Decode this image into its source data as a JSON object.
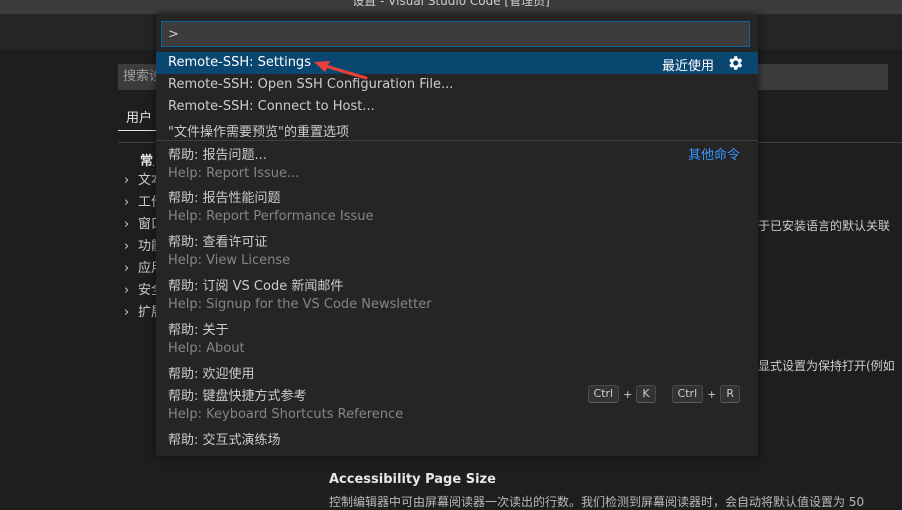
{
  "window": {
    "title": "设置 - Visual Studio Code [管理员]"
  },
  "settings": {
    "search_placeholder": "搜索设",
    "user_tab": "用户",
    "toc_heading": "常用",
    "toc_items": [
      "文本",
      "工作",
      "窗口",
      "功能",
      "应用",
      "安全",
      "扩展"
    ],
    "right_fragment_1": "于已安装语言的默认关联",
    "right_fragment_2": "显式设置为保持打开(例如",
    "setting_title": "Accessibility Page Size",
    "setting_desc": "控制编辑器中可由屏幕阅读器一次读出的行数。我们检测到屏幕阅读器时，会自动将默认值设置为 50"
  },
  "palette": {
    "input_value": ">",
    "recently_used": "最近使用",
    "other_commands": "其他命令",
    "items": [
      {
        "label": "Remote-SSH: Settings"
      },
      {
        "label": "Remote-SSH: Open SSH Configuration File..."
      },
      {
        "label": "Remote-SSH: Connect to Host..."
      },
      {
        "label": "\"文件操作需要预览\"的重置选项"
      },
      {
        "label": "帮助: 报告问题...",
        "detail": "Help: Report Issue..."
      },
      {
        "label": "帮助: 报告性能问题",
        "detail": "Help: Report Performance Issue"
      },
      {
        "label": "帮助: 查看许可证",
        "detail": "Help: View License"
      },
      {
        "label": "帮助: 订阅 VS Code 新闻邮件",
        "detail": "Help: Signup for the VS Code Newsletter"
      },
      {
        "label": "帮助: 关于",
        "detail": "Help: About"
      },
      {
        "label": "帮助: 欢迎使用"
      },
      {
        "label": "帮助: 键盘快捷方式参考",
        "detail": "Help: Keyboard Shortcuts Reference",
        "keybinding": {
          "chord1": [
            "Ctrl",
            "K"
          ],
          "chord2": [
            "Ctrl",
            "R"
          ]
        }
      },
      {
        "label": "帮助: 交互式演练场"
      }
    ]
  },
  "colors": {
    "accent": "#0e639c",
    "selected_row": "#094771",
    "link": "#3794ff",
    "annotation_arrow": "#e8413a"
  }
}
